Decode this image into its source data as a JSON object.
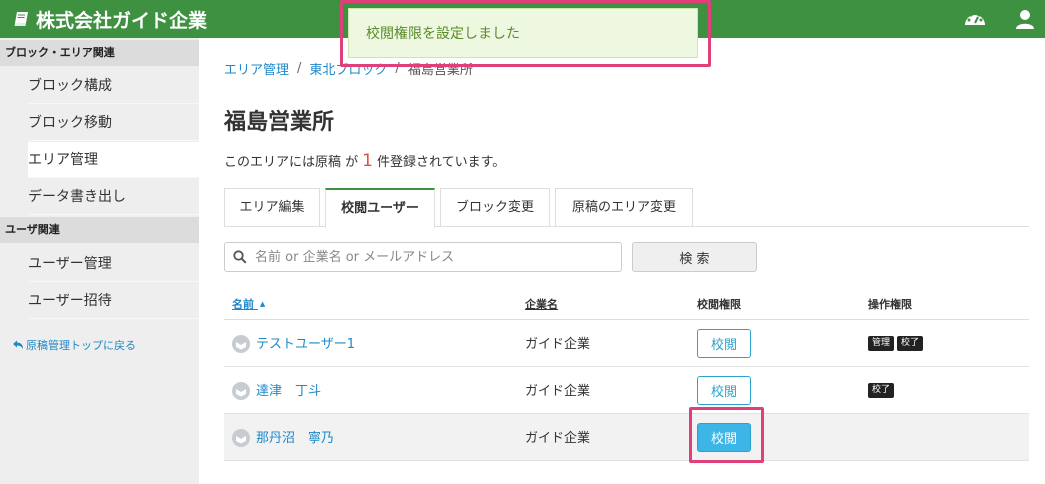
{
  "header": {
    "brand": "株式会社ガイド企業",
    "book_icon": "book-icon",
    "dashboard_icon": "dashboard-icon",
    "user_icon": "user-icon"
  },
  "sidebar": {
    "section1": "ブロック・エリア関連",
    "items1": [
      "ブロック構成",
      "ブロック移動",
      "エリア管理",
      "データ書き出し"
    ],
    "section2": "ユーザ関連",
    "items2": [
      "ユーザー管理",
      "ユーザー招待"
    ],
    "back_link": "原稿管理トップに戻る"
  },
  "breadcrumb": {
    "root": "エリア管理",
    "sep": "/",
    "block": "東北ブロック",
    "current": "福島営業所"
  },
  "page": {
    "title": "福島営業所",
    "count_prefix": "このエリアには原稿 が",
    "count": "1",
    "count_suffix": "件登録されています。"
  },
  "tabs": [
    "エリア編集",
    "校閲ユーザー",
    "ブロック変更",
    "原稿のエリア変更"
  ],
  "search": {
    "placeholder": "名前 or 企業名 or メールアドレス",
    "value": "",
    "button": "検 索"
  },
  "table": {
    "headers": {
      "name": "名前",
      "sort_indicator": "▲",
      "company": "企業名",
      "review": "校閲権限",
      "ops": "操作権限"
    },
    "rows": [
      {
        "name": "テストユーザー1",
        "company": "ガイド企業",
        "review": "校閲",
        "review_on": false,
        "badges": [
          "管理",
          "校了"
        ]
      },
      {
        "name": "達津　丁斗",
        "company": "ガイド企業",
        "review": "校閲",
        "review_on": false,
        "badges": [
          "校了"
        ]
      },
      {
        "name": "那丹沼　寧乃",
        "company": "ガイド企業",
        "review": "校閲",
        "review_on": true,
        "badges": []
      }
    ]
  },
  "toast": {
    "message": "校閲権限を設定しました"
  },
  "colors": {
    "header_bg": "#3f9142",
    "link": "#1e88c8",
    "review_active": "#3db5e6",
    "highlight_border": "#e0407a",
    "toast_bg": "#eef7e0"
  }
}
